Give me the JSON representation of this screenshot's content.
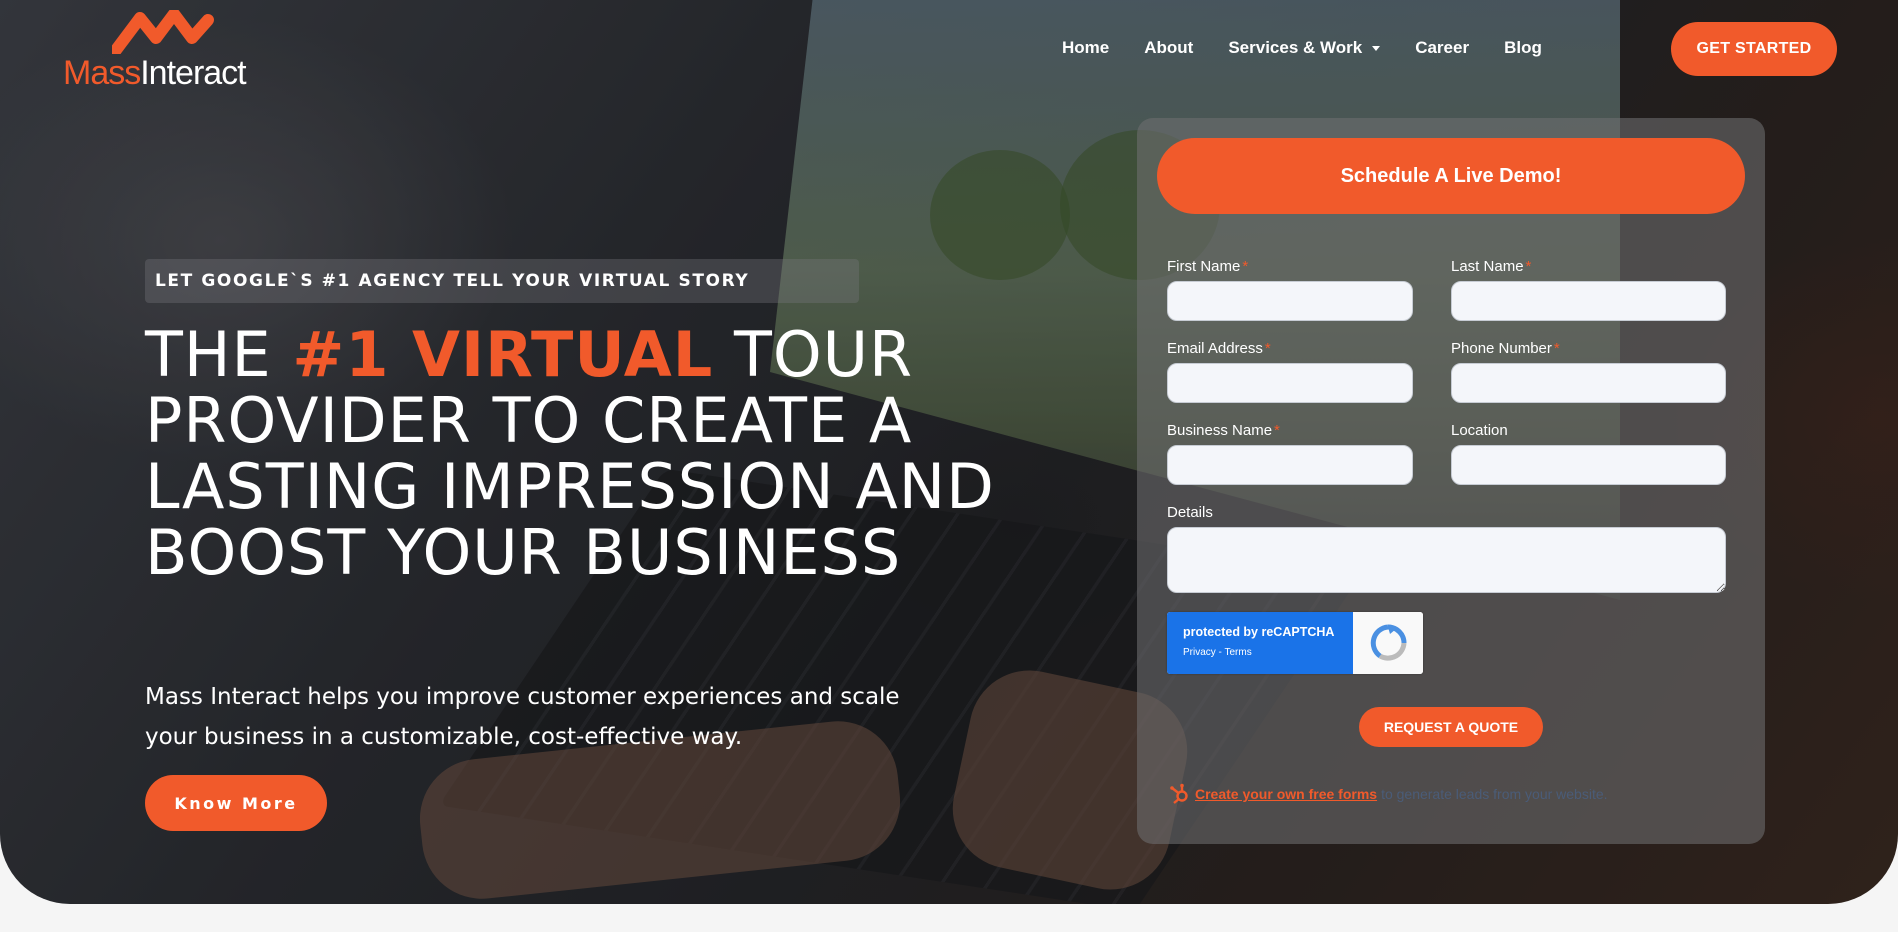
{
  "brand": {
    "name_part1": "Mass",
    "name_part2": "Interact"
  },
  "nav": {
    "items": [
      {
        "label": "Home"
      },
      {
        "label": "About"
      },
      {
        "label": "Services & Work"
      },
      {
        "label": "Career"
      },
      {
        "label": "Blog"
      }
    ],
    "cta": "GET STARTED"
  },
  "hero": {
    "tagline": "LET GOOGLE`S #1 AGENCY TELL YOUR VIRTUAL STORY",
    "headline_pre": "THE ",
    "headline_highlight": "#1 VIRTUAL",
    "headline_post": " TOUR PROVIDER TO CREATE A LASTING IMPRESSION AND BOOST YOUR BUSINESS",
    "description": "Mass Interact helps you improve customer experiences and scale your business in a customizable, cost-effective way.",
    "button": "Know More"
  },
  "form": {
    "header": "Schedule A Live Demo!",
    "fields": {
      "first_name": {
        "label": "First Name",
        "required": "*",
        "value": ""
      },
      "last_name": {
        "label": "Last Name",
        "required": "*",
        "value": ""
      },
      "email": {
        "label": "Email Address",
        "required": "*",
        "value": ""
      },
      "phone": {
        "label": "Phone Number",
        "required": "*",
        "value": ""
      },
      "business": {
        "label": "Business Name",
        "required": "*",
        "value": ""
      },
      "location": {
        "label": "Location",
        "value": ""
      },
      "details": {
        "label": "Details",
        "value": ""
      }
    },
    "recaptcha": {
      "title": "protected by reCAPTCHA",
      "links": "Privacy - Terms"
    },
    "submit": "REQUEST A QUOTE",
    "hubspot": {
      "link": "Create your own free forms",
      "rest": "to generate leads from your website."
    }
  },
  "colors": {
    "accent": "#f15a2b",
    "field_bg": "#f4f6fa",
    "recaptcha_blue": "#1a73e8"
  }
}
